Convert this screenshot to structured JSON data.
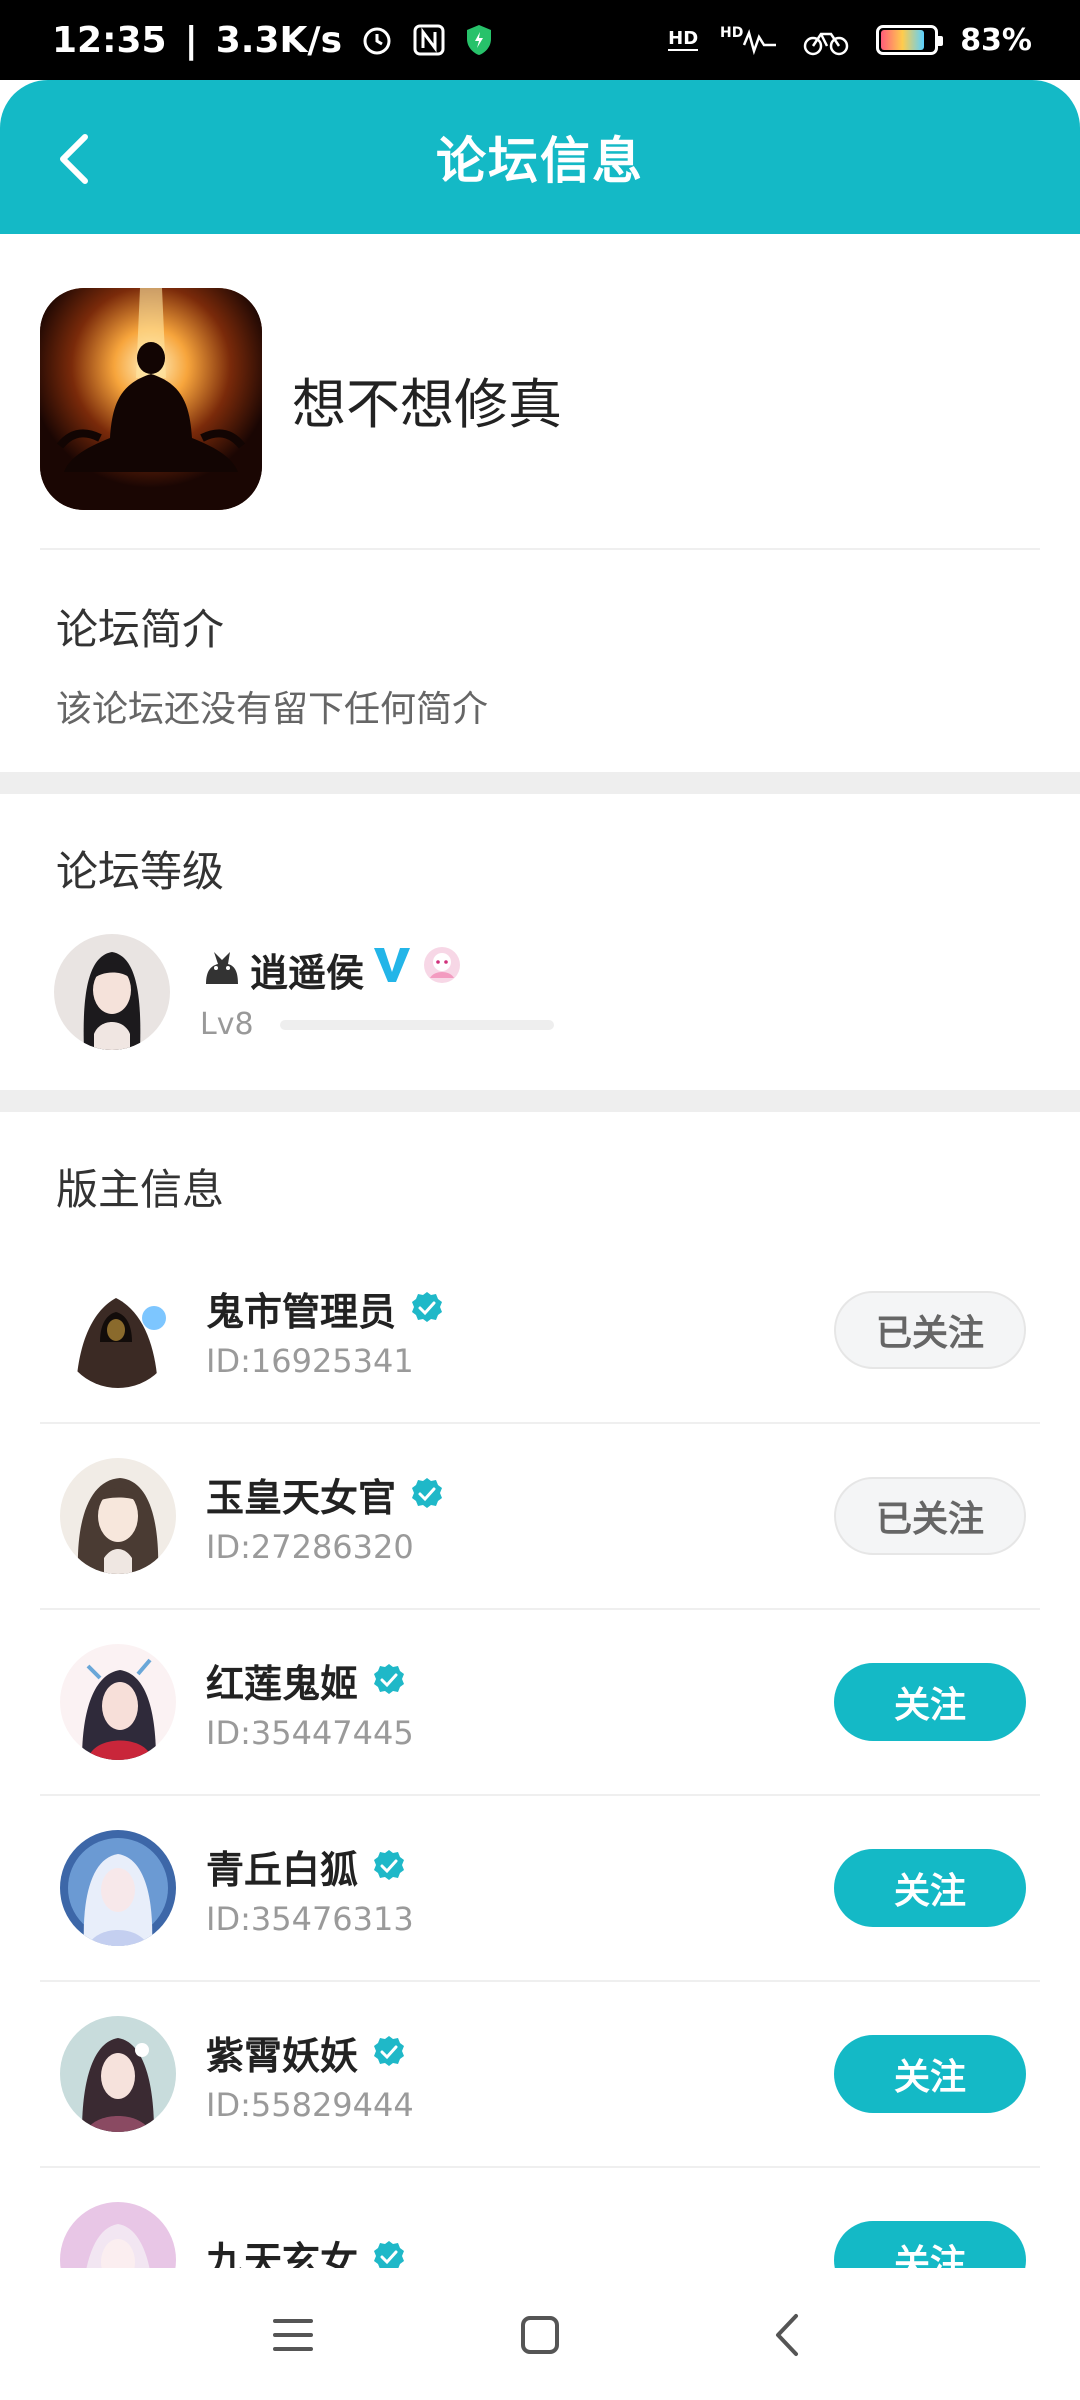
{
  "status_bar": {
    "time": "12:35",
    "speed": "3.3K/s",
    "battery": "83%",
    "battery_level": 0.83
  },
  "header": {
    "title": "论坛信息"
  },
  "forum": {
    "name": "想不想修真"
  },
  "intro": {
    "title": "论坛简介",
    "text": "该论坛还没有留下任何简介"
  },
  "level": {
    "title": "论坛等级",
    "user_name": "逍遥侯",
    "level_label": "Lv8",
    "progress": 0
  },
  "moderators": {
    "title": "版主信息",
    "items": [
      {
        "name": "鬼市管理员",
        "id": "ID:16925341",
        "button": "已关注",
        "followed": true
      },
      {
        "name": "玉皇天女官",
        "id": "ID:27286320",
        "button": "已关注",
        "followed": true
      },
      {
        "name": "红莲鬼姬",
        "id": "ID:35447445",
        "button": "关注",
        "followed": false
      },
      {
        "name": "青丘白狐",
        "id": "ID:35476313",
        "button": "关注",
        "followed": false
      },
      {
        "name": "紫霄妖妖",
        "id": "ID:55829444",
        "button": "关注",
        "followed": false
      },
      {
        "name": "九天玄女",
        "id": "",
        "button": "关注",
        "followed": false
      }
    ]
  },
  "colors": {
    "accent": "#14b9c6",
    "verified": "#1fb8c8"
  }
}
